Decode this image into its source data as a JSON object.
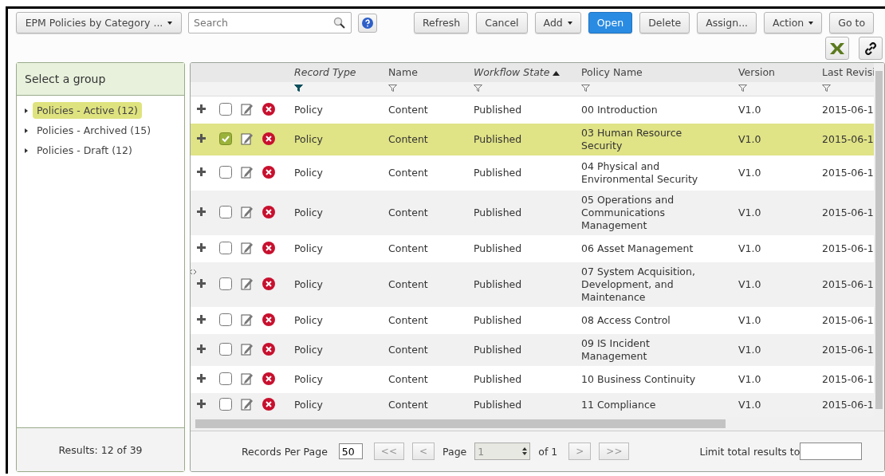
{
  "toolbar": {
    "view_select": "EPM Policies by Category ...",
    "search": {
      "placeholder": "Search"
    },
    "buttons": [
      {
        "label": "Refresh",
        "kind": "plain"
      },
      {
        "label": "Cancel",
        "kind": "plain"
      },
      {
        "label": "Add",
        "kind": "dropdown"
      },
      {
        "label": "Open",
        "kind": "primary"
      },
      {
        "label": "Delete",
        "kind": "plain"
      },
      {
        "label": "Assign...",
        "kind": "plain"
      },
      {
        "label": "Action",
        "kind": "dropdown"
      },
      {
        "label": "Go to",
        "kind": "plain"
      }
    ]
  },
  "sidebar": {
    "title": "Select a group",
    "groups": [
      {
        "label": "Policies - Active (12)",
        "selected": true
      },
      {
        "label": "Policies - Archived (15)",
        "selected": false
      },
      {
        "label": "Policies - Draft (12)",
        "selected": false
      }
    ],
    "results": "Results: 12 of 39"
  },
  "table": {
    "columns": [
      {
        "label": "Record Type",
        "filter_active": true,
        "sorted_ascending": false
      },
      {
        "label": "Name",
        "filter_active": false,
        "sorted_ascending": false
      },
      {
        "label": "Workflow State",
        "filter_active": false,
        "sorted_ascending": true
      },
      {
        "label": "Policy Name",
        "filter_active": false,
        "sorted_ascending": false
      },
      {
        "label": "Version",
        "filter_active": false,
        "sorted_ascending": false
      },
      {
        "label": "Last Revisi",
        "filter_active": false,
        "sorted_ascending": false
      }
    ],
    "rows": [
      {
        "selected": false,
        "cells": [
          "Policy",
          "Content",
          "Published",
          "00 Introduction",
          "V1.0",
          "2015-06-1"
        ]
      },
      {
        "selected": true,
        "cells": [
          "Policy",
          "Content",
          "Published",
          "03 Human Resource Security",
          "V1.0",
          "2015-06-1"
        ]
      },
      {
        "selected": false,
        "cells": [
          "Policy",
          "Content",
          "Published",
          "04 Physical and Environmental Security",
          "V1.0",
          "2015-06-1"
        ]
      },
      {
        "selected": false,
        "cells": [
          "Policy",
          "Content",
          "Published",
          "05 Operations and Communications Management",
          "V1.0",
          "2015-06-1"
        ]
      },
      {
        "selected": false,
        "cells": [
          "Policy",
          "Content",
          "Published",
          "06 Asset Management",
          "V1.0",
          "2015-06-1"
        ]
      },
      {
        "selected": false,
        "cells": [
          "Policy",
          "Content",
          "Published",
          "07 System Acquisition, Development, and Maintenance",
          "V1.0",
          "2015-06-1"
        ]
      },
      {
        "selected": false,
        "cells": [
          "Policy",
          "Content",
          "Published",
          "08 Access Control",
          "V1.0",
          "2015-06-1"
        ]
      },
      {
        "selected": false,
        "cells": [
          "Policy",
          "Content",
          "Published",
          "09 IS Incident Management",
          "V1.0",
          "2015-06-1"
        ]
      },
      {
        "selected": false,
        "cells": [
          "Policy",
          "Content",
          "Published",
          "10 Business Continuity",
          "V1.0",
          "2015-06-1"
        ]
      },
      {
        "selected": false,
        "cells": [
          "Policy",
          "Content",
          "Published",
          "11 Compliance",
          "V1.0",
          "2015-06-1"
        ]
      }
    ]
  },
  "pager": {
    "records_per_page_label": "Records Per Page",
    "records_per_page": "50",
    "nav_before": [
      {
        "label": "<<",
        "disabled": true
      },
      {
        "label": "<",
        "disabled": true
      }
    ],
    "page_label": "Page",
    "page": "1",
    "page_disabled": true,
    "of_label": "of 1",
    "nav_after": [
      {
        "label": ">",
        "disabled": true
      },
      {
        "label": ">>",
        "disabled": true
      }
    ],
    "limit_label": "Limit total results to"
  }
}
